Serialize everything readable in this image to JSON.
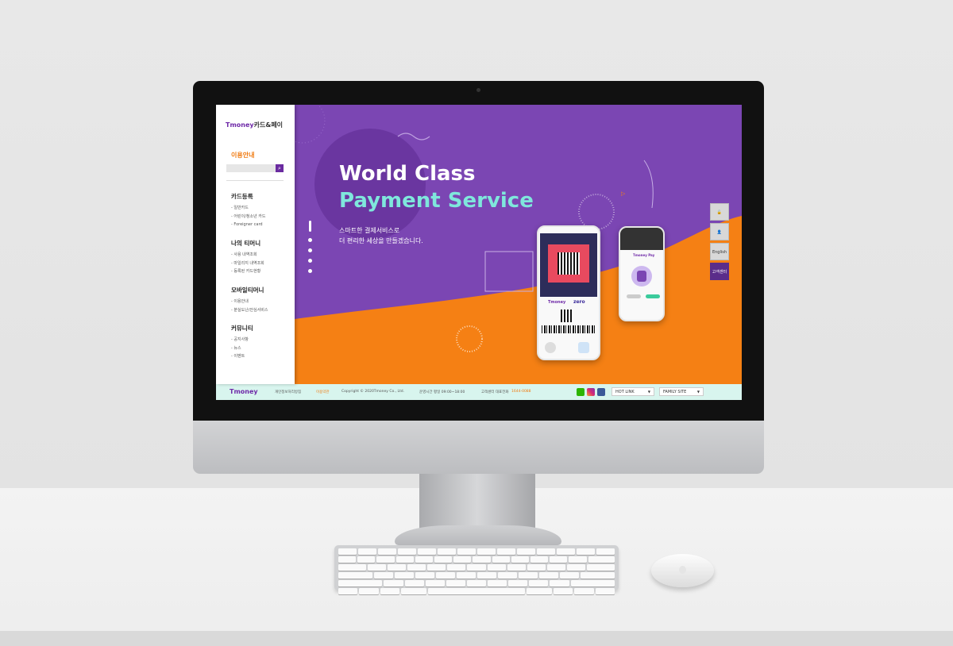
{
  "brand": {
    "logo_t": "Tmoney",
    "logo_rest": "카드&페이"
  },
  "sidebar": {
    "section_title": "이용안내",
    "search_icon": "search-icon",
    "groups": [
      {
        "title": "카드등록",
        "items": [
          "- 일반카드",
          "- 어린이/청소년 카드",
          "- Foreigner card"
        ]
      },
      {
        "title": "나의 티머니",
        "items": [
          "- 사용 내역조회",
          "- 마일리지 내역조회",
          "- 등록된 카드현황"
        ]
      },
      {
        "title": "모바일티머니",
        "items": [
          "- 이용안내",
          "- 분실도난/안심서비스"
        ]
      },
      {
        "title": "커뮤니티",
        "items": [
          "- 공지사항",
          "- 뉴스",
          "- 이벤트"
        ]
      }
    ]
  },
  "hero": {
    "title_line1": "World Class",
    "title_line2": "Payment Service",
    "subtitle_line1": "스마트한 결제서비스로",
    "subtitle_line2": "더 편리한 세상을 만들겠습니다.",
    "phone1": {
      "brand": "Tmoney",
      "partner": "zero"
    },
    "phone2": {
      "brand": "Tmoney Pay"
    }
  },
  "side_panel": {
    "lock_icon": "lock-icon",
    "user_icon": "user-icon",
    "english": "English",
    "customer_center": "고객센터"
  },
  "footer": {
    "logo": "Tmoney",
    "privacy": "개인정보처리방침",
    "terms": "이용약관",
    "copyright": "Copyright © 2020Tmoney Co., Ltd.",
    "hours": "운영시간 평일 09:00~18:00",
    "phone_label": "고객센터 대표전화",
    "phone": "1644-0088",
    "hot_link": "HOT LINK",
    "family_site": "FAMILY SITE"
  },
  "colors": {
    "purple": "#7b46b3",
    "orange": "#f07b12",
    "mint": "#7fe7dc",
    "footer_bg": "#d8f5ee"
  }
}
